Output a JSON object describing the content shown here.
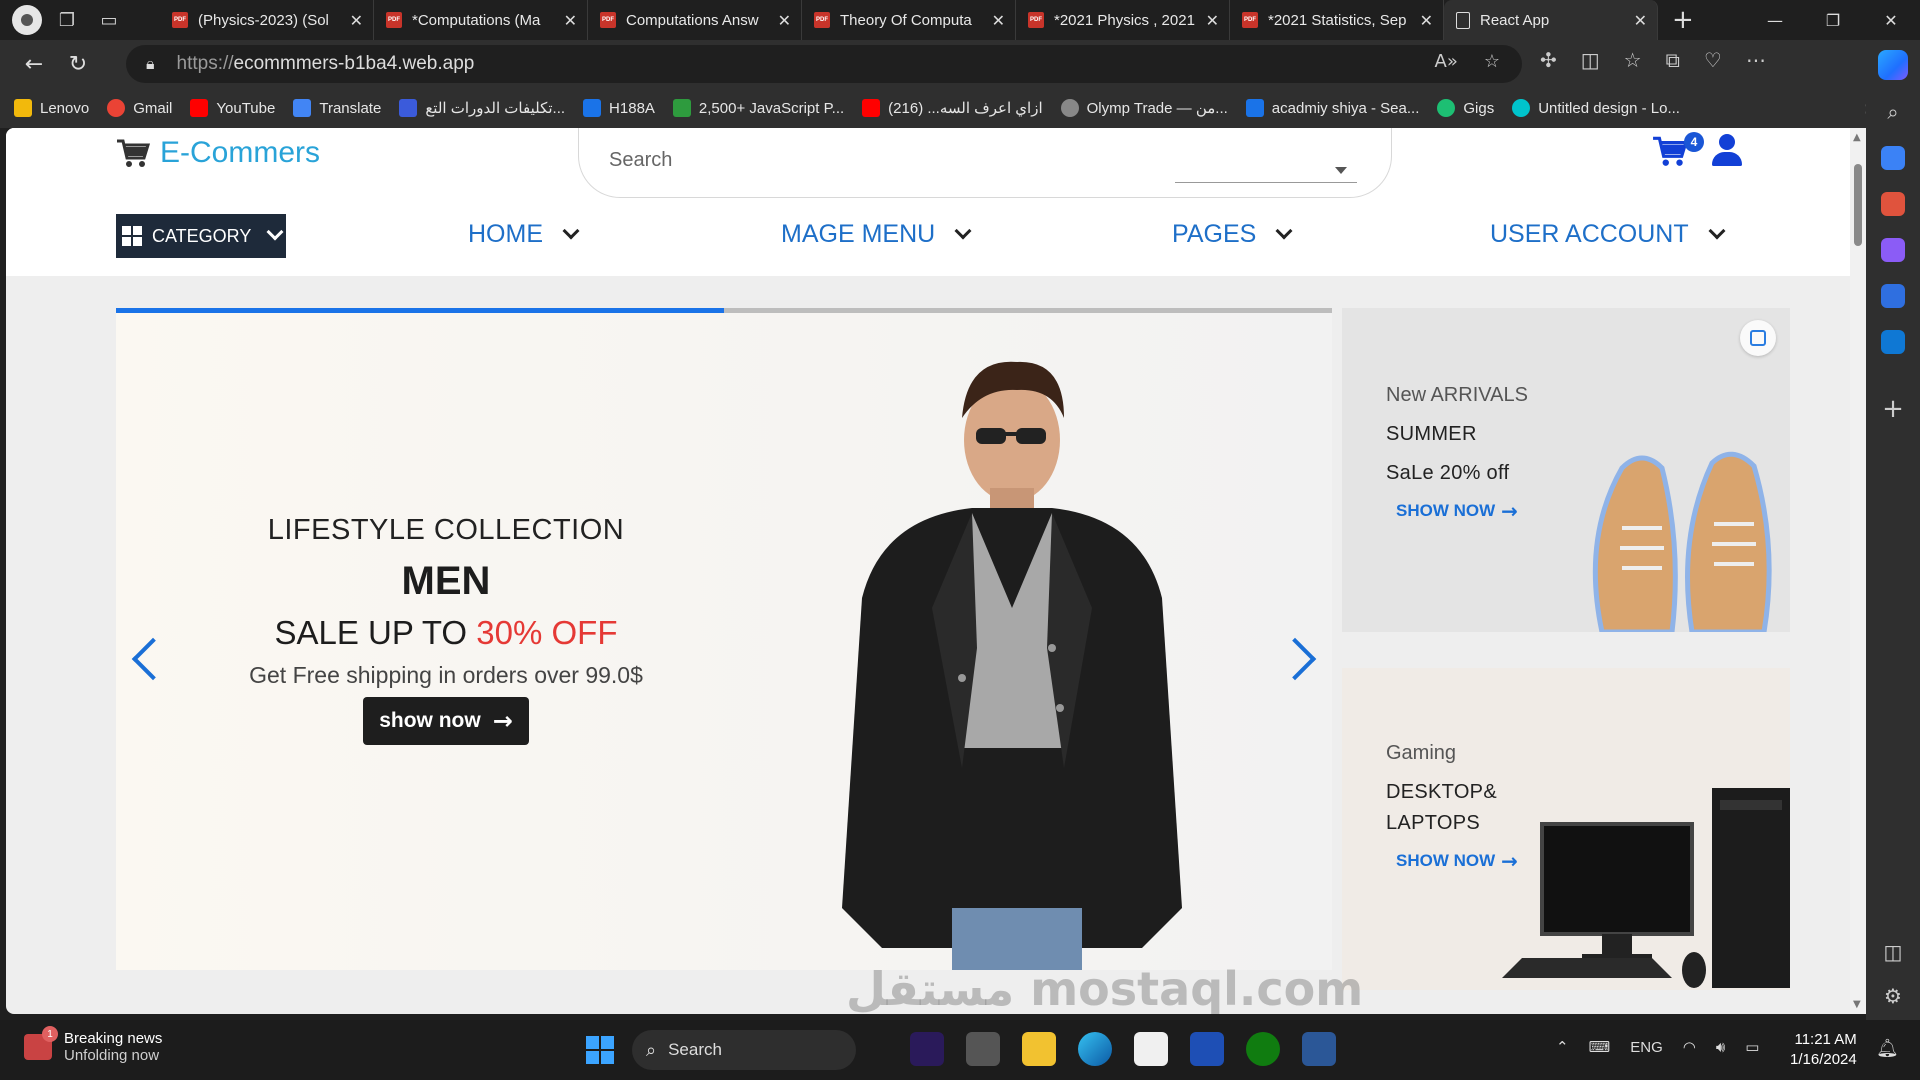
{
  "browser": {
    "tabs": [
      {
        "title": "(Physics-2023) (Sol",
        "icon": "pdf-icon"
      },
      {
        "title": "*Computations (Ma",
        "icon": "pdf-icon"
      },
      {
        "title": "Computations Answ",
        "icon": "pdf-icon"
      },
      {
        "title": "Theory Of Computa",
        "icon": "pdf-icon"
      },
      {
        "title": "*2021 Physics , 2021",
        "icon": "pdf-icon"
      },
      {
        "title": "*2021 Statistics, Sep",
        "icon": "pdf-icon"
      },
      {
        "title": "React App",
        "icon": "document-icon",
        "active": true
      }
    ],
    "url_protocol": "https://",
    "url_host": "ecommmers-b1ba4.web.app",
    "bookmarks": [
      {
        "label": "Lenovo",
        "color": "#f2b90c"
      },
      {
        "label": "Gmail",
        "color": "#ea4335"
      },
      {
        "label": "YouTube",
        "color": "#ff0000"
      },
      {
        "label": "Translate",
        "color": "#4285f4"
      },
      {
        "label": "تكليفات الدورات التع...",
        "color": "#3b5bdb"
      },
      {
        "label": "H188A",
        "color": "#1a73e8"
      },
      {
        "label": "2,500+ JavaScript P...",
        "color": "#2e9b3e"
      },
      {
        "label": "ازاي اعرف السه... (216)",
        "color": "#ff0000"
      },
      {
        "label": "Olymp Trade — من...",
        "color": "#888888"
      },
      {
        "label": "acadmiy shiya - Sea...",
        "color": "#1a73e8"
      },
      {
        "label": "Gigs",
        "color": "#1dbf73"
      },
      {
        "label": "Untitled design - Lo...",
        "color": "#00c4cc"
      }
    ]
  },
  "site": {
    "logo": "E-Commers",
    "search_placeholder": "Search",
    "cart_count": "4",
    "category_label": "CATEGORY",
    "menu": [
      "HOME",
      "MAGE MENU",
      "PAGES",
      "USER ACCOUNT"
    ],
    "slider_progress": 0.5,
    "hero": {
      "kicker": "LIFESTYLE COLLECTION",
      "title": "MEN",
      "sale_prefix": "SALE UP TO ",
      "sale_pct": "30% OFF",
      "subtitle": "Get Free shipping in orders over 99.0$",
      "cta": "show now"
    },
    "card1": {
      "line1": "New ARRIVALS",
      "line2": "SUMMER",
      "line3": "SaLe 20% off",
      "link": "SHOW NOW"
    },
    "card2": {
      "line1": "Gaming",
      "line2": "DESKTOP&",
      "line3": "LAPTOPS",
      "link": "SHOW NOW"
    },
    "watermark": "مستقل mostaql.com"
  },
  "taskbar": {
    "news_title": "Breaking news",
    "news_sub": "Unfolding now",
    "search_label": "Search",
    "lang": "ENG",
    "time": "11:21 AM",
    "date": "1/16/2024"
  },
  "colors": {
    "accent": "#1a6fd6",
    "logo": "#29a3d8",
    "sale": "#e53935",
    "category_bg": "#1e2a3a"
  }
}
